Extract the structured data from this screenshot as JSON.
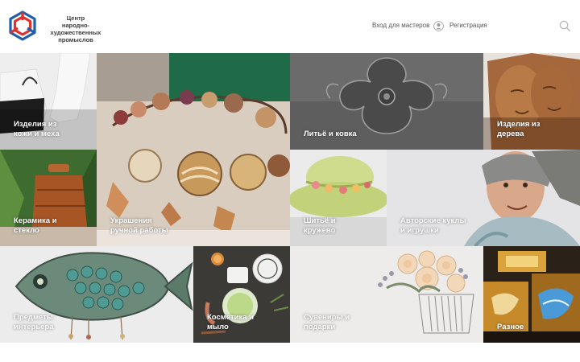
{
  "header": {
    "logo_lines": [
      "Центр",
      "народно-художественных",
      "промыслов"
    ],
    "login_label": "Вход для мастеров",
    "register_label": "Регистрация",
    "icons": {
      "user": "user-icon",
      "search": "search-icon",
      "logo": "logo-icon"
    }
  },
  "categories": [
    {
      "label": "Изделия из\nкожи и меха"
    },
    {
      "label": "Украшения\nручной работы"
    },
    {
      "label": "Литьё и ковка"
    },
    {
      "label": "Изделия из\nдерева"
    },
    {
      "label": "Керамика и\nстекло"
    },
    {
      "label": "Шитьё и\nкружево"
    },
    {
      "label": "Авторские куклы\nи игрушки"
    },
    {
      "label": "Предметы\nинтерьера"
    },
    {
      "label": "Косметика и\nмыло"
    },
    {
      "label": "Сувениры и\nподарки"
    },
    {
      "label": "Разное"
    }
  ],
  "colors": {
    "logo_red": "#e0322d",
    "logo_blue": "#1f5fae",
    "label_text": "#ffffff",
    "header_text": "#555555"
  }
}
